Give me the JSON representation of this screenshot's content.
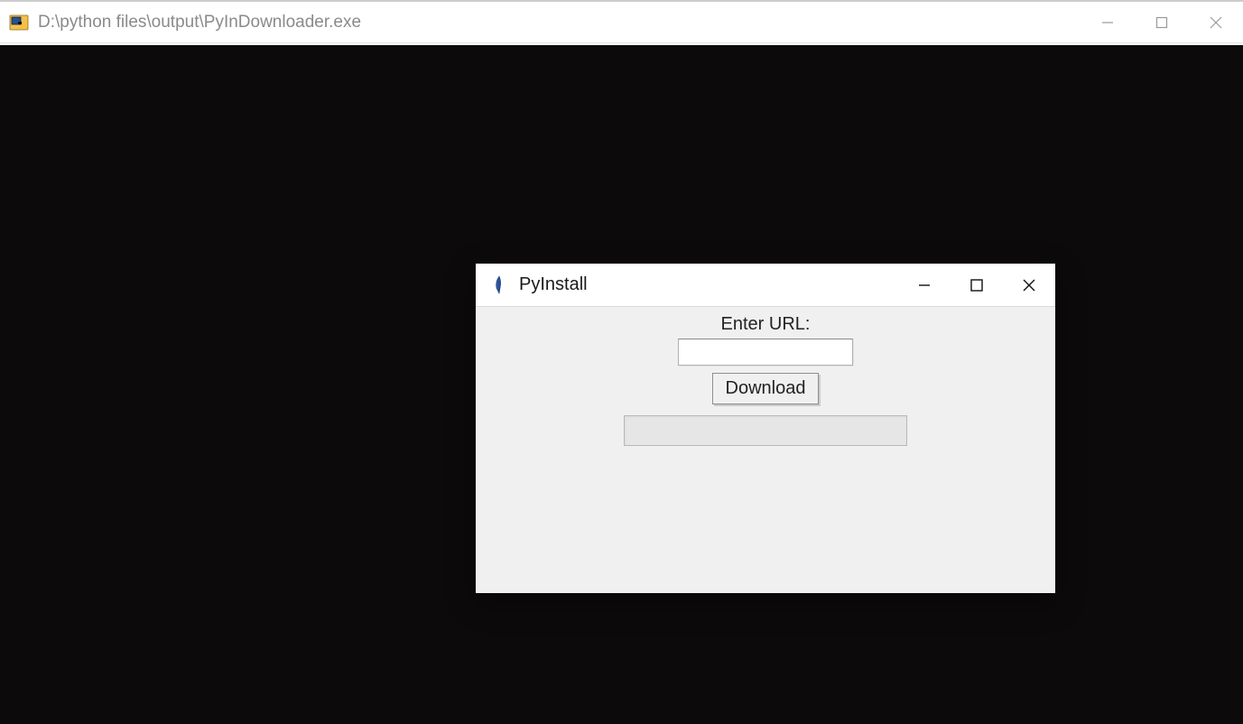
{
  "outer_window": {
    "title": "D:\\python files\\output\\PyInDownloader.exe"
  },
  "inner_window": {
    "title": "PyInstall",
    "url_label": "Enter URL:",
    "url_value": "",
    "download_label": "Download",
    "progress_value": 0
  }
}
